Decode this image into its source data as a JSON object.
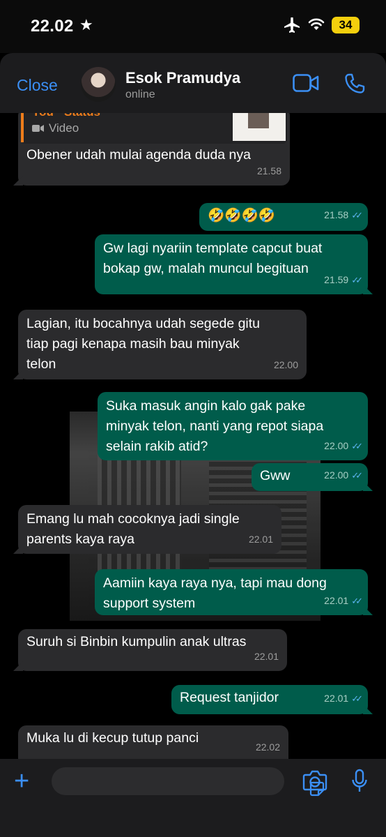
{
  "status_bar": {
    "time": "22.02",
    "battery": "34"
  },
  "header": {
    "close_label": "Close",
    "contact_name": "Esok Pramudya",
    "presence": "online"
  },
  "reply_preview": {
    "title": "You · Status",
    "media_label": "Video"
  },
  "messages": [
    {
      "dir": "in",
      "text": "Obener udah mulai agenda duda nya",
      "time": "21.58"
    },
    {
      "dir": "out",
      "text": "🤣🤣🤣🤣",
      "time": "21.58",
      "read": true
    },
    {
      "dir": "out",
      "text": "Gw lagi nyariin template capcut buat\nbokap gw, malah muncul begituan",
      "time": "21.59",
      "read": true
    },
    {
      "dir": "in",
      "text": "Lagian, itu bocahnya udah segede gitu\ntiap pagi kenapa masih bau minyak\ntelon",
      "time": "22.00"
    },
    {
      "dir": "out",
      "text": "Suka masuk angin kalo gak pake\nminyak telon, nanti yang repot siapa\nselain rakib atid?",
      "time": "22.00",
      "read": true
    },
    {
      "dir": "out",
      "text": "Gww",
      "time": "22.00",
      "read": true
    },
    {
      "dir": "in",
      "text": "Emang lu mah cocoknya jadi single\nparents kaya raya",
      "time": "22.01"
    },
    {
      "dir": "out",
      "text": "Aamiin kaya raya nya, tapi mau dong\nsupport system",
      "time": "22.01",
      "read": true
    },
    {
      "dir": "in",
      "text": "Suruh si Binbin kumpulin anak ultras",
      "time": "22.01"
    },
    {
      "dir": "out",
      "text": "Request tanjidor",
      "time": "22.01",
      "read": true
    },
    {
      "dir": "in",
      "text": "Muka lu di kecup tutup panci",
      "time": "22.02"
    }
  ],
  "colors": {
    "accent": "#3b8ff5",
    "outgoing_bubble": "#005c4b",
    "incoming_bubble": "#2b2b2d",
    "read_ticks": "#5ab4ef",
    "battery": "#f4cf0d"
  }
}
